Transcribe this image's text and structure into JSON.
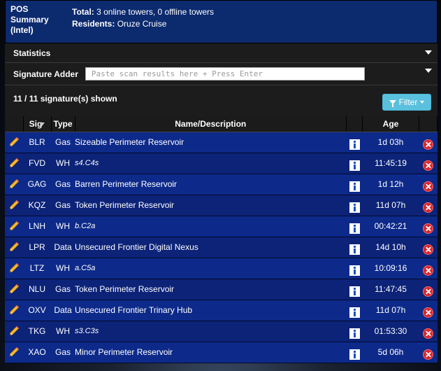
{
  "pos": {
    "title_line1": "POS",
    "title_line2": "Summary",
    "title_line3": "(Intel)",
    "total_label": "Total:",
    "total_value": " 3 online towers, 0 offline towers",
    "residents_label": "Residents:",
    "residents_value": " Oruze Cruise"
  },
  "statistics": {
    "label": "Statistics"
  },
  "signature_adder": {
    "label": "Signature Adder",
    "placeholder": "Paste scan results here + Press Enter"
  },
  "count_text": "11 / 11 signature(s) shown",
  "filter_label": "Filter",
  "table": {
    "headers": {
      "sig": "Sig",
      "type": "Type",
      "name": "Name/Description",
      "age": "Age"
    },
    "rows": [
      {
        "sig": "BLR",
        "type": "Gas",
        "name": "Sizeable Perimeter Reservoir",
        "italic": false,
        "age": "1d 03h"
      },
      {
        "sig": "FVD",
        "type": "WH",
        "name": "s4.C4s",
        "italic": true,
        "age": "11:45:19"
      },
      {
        "sig": "GAG",
        "type": "Gas",
        "name": "Barren Perimeter Reservoir",
        "italic": false,
        "age": "1d 12h"
      },
      {
        "sig": "KQZ",
        "type": "Gas",
        "name": "Token Perimeter Reservoir",
        "italic": false,
        "age": "11d 07h"
      },
      {
        "sig": "LNH",
        "type": "WH",
        "name": "b.C2a",
        "italic": true,
        "age": "00:42:21"
      },
      {
        "sig": "LPR",
        "type": "Data",
        "name": "Unsecured Frontier Digital Nexus",
        "italic": false,
        "age": "14d 10h"
      },
      {
        "sig": "LTZ",
        "type": "WH",
        "name": "a.C5a",
        "italic": true,
        "age": "10:09:16"
      },
      {
        "sig": "NLU",
        "type": "Gas",
        "name": "Token Perimeter Reservoir",
        "italic": false,
        "age": "11:47:45"
      },
      {
        "sig": "OXV",
        "type": "Data",
        "name": "Unsecured Frontier Trinary Hub",
        "italic": false,
        "age": "11d 07h"
      },
      {
        "sig": "TKG",
        "type": "WH",
        "name": "s3.C3s",
        "italic": true,
        "age": "01:53:30"
      },
      {
        "sig": "XAO",
        "type": "Gas",
        "name": "Minor Perimeter Reservoir",
        "italic": false,
        "age": "5d 06h"
      }
    ]
  },
  "icons": {
    "edit": "pencil-icon",
    "info": "info-icon",
    "delete": "delete-icon",
    "filter": "funnel-icon"
  },
  "colors": {
    "row_blue": "#0d2a8a",
    "pos_blue": "#0c2a6e",
    "filter_btn": "#5bc0de",
    "delete_red": "#d8262b"
  }
}
